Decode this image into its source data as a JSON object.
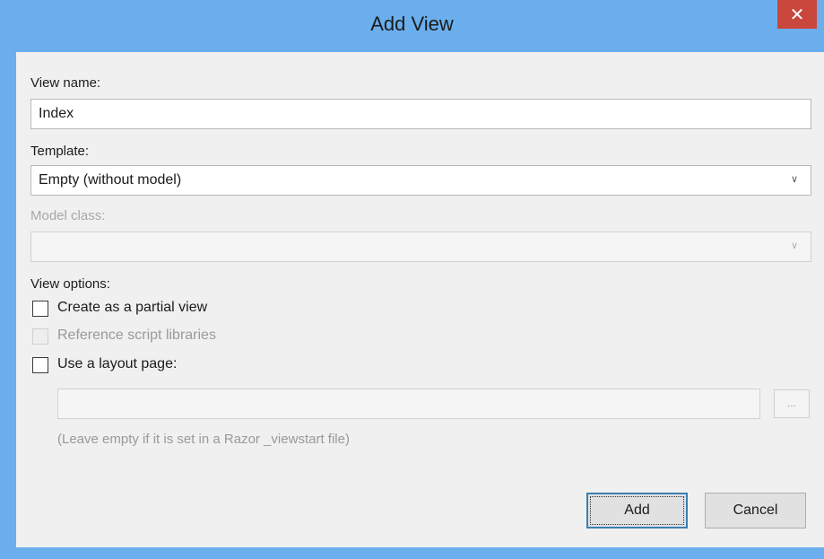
{
  "window": {
    "title": "Add View",
    "close_glyph": "✕"
  },
  "form": {
    "view_name": {
      "label": "View name:",
      "value": "Index"
    },
    "template": {
      "label": "Template:",
      "value": "Empty (without model)"
    },
    "model_class": {
      "label": "Model class:",
      "value": ""
    },
    "view_options": {
      "label": "View options:",
      "create_partial": {
        "label": "Create as a partial view",
        "checked": false
      },
      "reference_scripts": {
        "label": "Reference script libraries",
        "checked": false,
        "enabled": false
      },
      "use_layout": {
        "label": "Use a layout page:",
        "checked": false
      },
      "layout_path": {
        "value": ""
      },
      "browse_label": "...",
      "hint": "(Leave empty if it is set in a Razor _viewstart file)"
    }
  },
  "buttons": {
    "add": "Add",
    "cancel": "Cancel"
  },
  "colors": {
    "titlebar": "#6aaeed",
    "client_bg": "#f0f0f0",
    "close": "#c9473d",
    "default_button_border": "#3c7fb1"
  },
  "icons": {
    "dropdown": "chevron-down-icon",
    "close": "close-icon"
  }
}
